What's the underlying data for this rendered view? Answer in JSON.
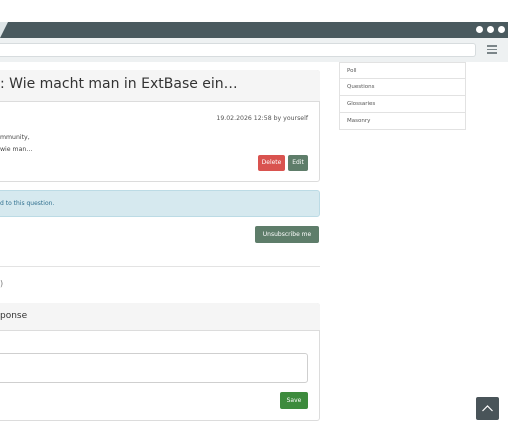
{
  "question": {
    "title": ": Wie macht man in ExtBase ein…",
    "meta": "19.02.2026 12:58 by yourself",
    "body_line1": "mmunity,",
    "body_line2": "wie man…",
    "delete_label": "Delete",
    "edit_label": "Edit"
  },
  "subscription": {
    "alert_text": "d to this question.",
    "unsubscribe_label": "Unsubscribe me"
  },
  "answers": {
    "count_text": ")"
  },
  "response": {
    "title": "ponse",
    "textarea_value": "",
    "save_label": "Save"
  },
  "sidebar": {
    "items": [
      {
        "label": "Poll"
      },
      {
        "label": "Questions"
      },
      {
        "label": "Glossaries"
      },
      {
        "label": "Masonry"
      }
    ]
  },
  "icons": {
    "menu": "hamburger-icon",
    "scroll_top": "chevron-up-icon"
  },
  "colors": {
    "chrome": "#4a5a5f",
    "danger": "#d9534f",
    "secondary": "#5e7d6a",
    "success": "#3d8b3d",
    "info_bg": "#d6e9ef"
  }
}
